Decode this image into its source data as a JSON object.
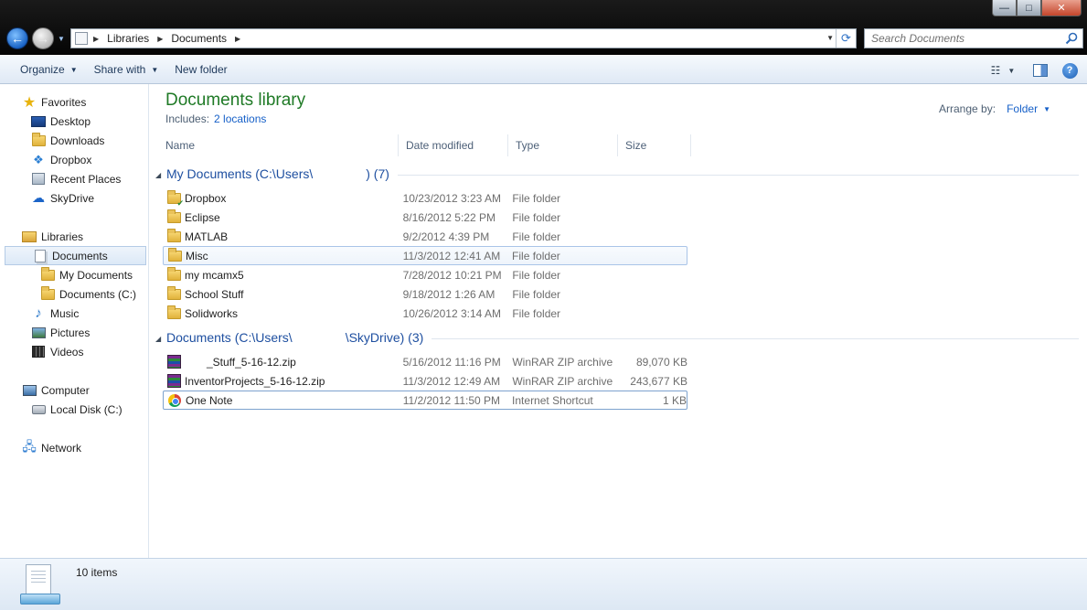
{
  "window": {
    "controls": {
      "minimize": "—",
      "maximize": "□",
      "close": "✕"
    }
  },
  "address": {
    "crumbs": [
      "Libraries",
      "Documents"
    ]
  },
  "search": {
    "placeholder": "Search Documents"
  },
  "toolbar": {
    "organize": "Organize",
    "share_with": "Share with",
    "new_folder": "New folder"
  },
  "nav": {
    "favorites": {
      "label": "Favorites",
      "items": [
        "Desktop",
        "Downloads",
        "Dropbox",
        "Recent Places",
        "SkyDrive"
      ]
    },
    "libraries": {
      "label": "Libraries",
      "documents": "Documents",
      "doc_children": [
        "My Documents",
        "Documents (C:)"
      ],
      "others": [
        "Music",
        "Pictures",
        "Videos"
      ]
    },
    "computer": {
      "label": "Computer",
      "items": [
        "Local Disk (C:)"
      ]
    },
    "network": {
      "label": "Network"
    }
  },
  "library": {
    "title": "Documents library",
    "includes_label": "Includes:",
    "includes_link": "2 locations",
    "arrange_label": "Arrange by:",
    "arrange_value": "Folder"
  },
  "columns": [
    "Name",
    "Date modified",
    "Type",
    "Size"
  ],
  "groups": [
    {
      "title_prefix": "My Documents (C:\\Users\\",
      "title_suffix": ") (7)",
      "rows": [
        {
          "name": "Dropbox",
          "date": "10/23/2012 3:23 AM",
          "type": "File folder",
          "size": "",
          "icon": "dropbox-folder-icon"
        },
        {
          "name": "Eclipse",
          "date": "8/16/2012 5:22 PM",
          "type": "File folder",
          "size": "",
          "icon": "folder-icon"
        },
        {
          "name": "MATLAB",
          "date": "9/2/2012 4:39 PM",
          "type": "File folder",
          "size": "",
          "icon": "folder-icon"
        },
        {
          "name": "Misc",
          "date": "11/3/2012 12:41 AM",
          "type": "File folder",
          "size": "",
          "icon": "folder-icon"
        },
        {
          "name": "my mcamx5",
          "date": "7/28/2012 10:21 PM",
          "type": "File folder",
          "size": "",
          "icon": "folder-icon"
        },
        {
          "name": "School Stuff",
          "date": "9/18/2012 1:26 AM",
          "type": "File folder",
          "size": "",
          "icon": "folder-icon"
        },
        {
          "name": "Solidworks",
          "date": "10/26/2012 3:14 AM",
          "type": "File folder",
          "size": "",
          "icon": "folder-icon"
        }
      ]
    },
    {
      "title_prefix": "Documents (C:\\Users\\",
      "title_suffix": "\\SkyDrive) (3)",
      "rows": [
        {
          "name": "_Stuff_5-16-12.zip",
          "date": "5/16/2012 11:16 PM",
          "type": "WinRAR ZIP archive",
          "size": "89,070 KB",
          "icon": "winrar-icon"
        },
        {
          "name": "InventorProjects_5-16-12.zip",
          "date": "11/3/2012 12:49 AM",
          "type": "WinRAR ZIP archive",
          "size": "243,677 KB",
          "icon": "winrar-icon"
        },
        {
          "name": "One Note",
          "date": "11/2/2012 11:50 PM",
          "type": "Internet Shortcut",
          "size": "1 KB",
          "icon": "chrome-icon"
        }
      ]
    }
  ],
  "status": {
    "count": "10 items"
  }
}
